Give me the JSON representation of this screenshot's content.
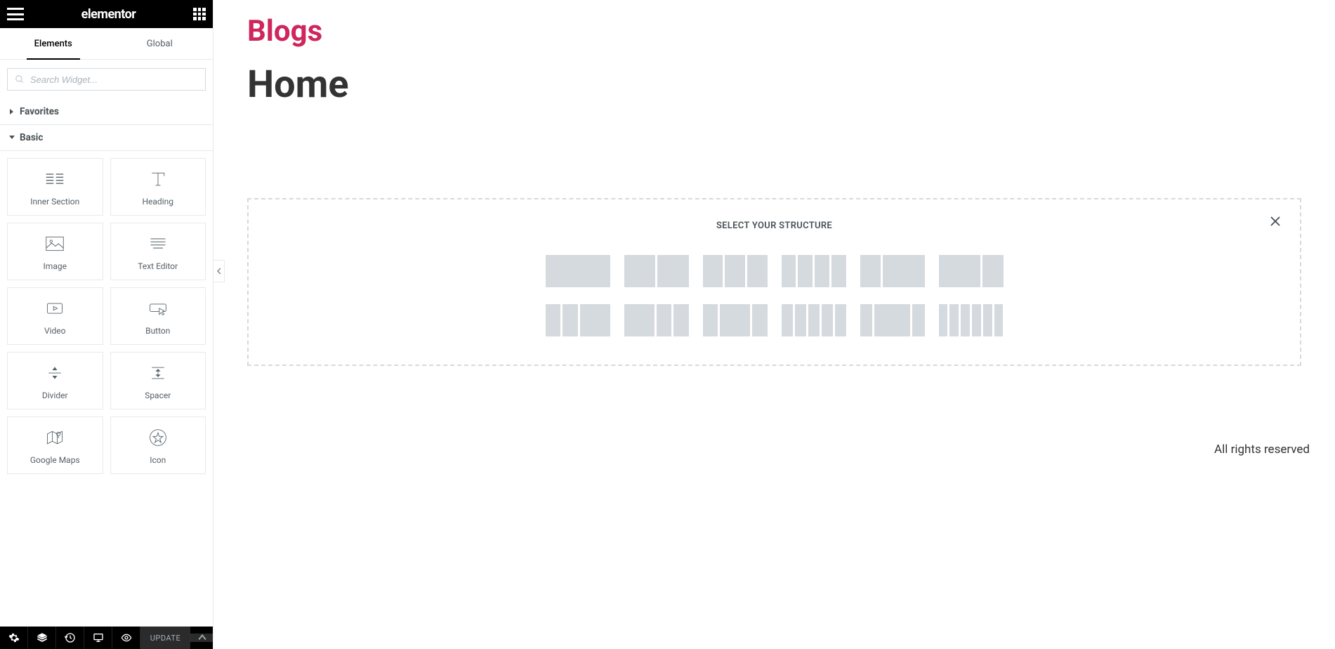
{
  "header": {
    "logo": "elementor"
  },
  "tabs": {
    "elements": "Elements",
    "global": "Global"
  },
  "search": {
    "placeholder": "Search Widget..."
  },
  "sections": {
    "favorites": "Favorites",
    "basic": "Basic"
  },
  "widgets": {
    "inner_section": "Inner Section",
    "heading": "Heading",
    "image": "Image",
    "text_editor": "Text Editor",
    "video": "Video",
    "button": "Button",
    "divider": "Divider",
    "spacer": "Spacer",
    "google_maps": "Google Maps",
    "icon": "Icon"
  },
  "bottom": {
    "update": "UPDATE"
  },
  "canvas": {
    "site_title": "Blogs",
    "page_title": "Home",
    "structure_title": "SELECT YOUR STRUCTURE",
    "footer": "All rights reserved"
  }
}
